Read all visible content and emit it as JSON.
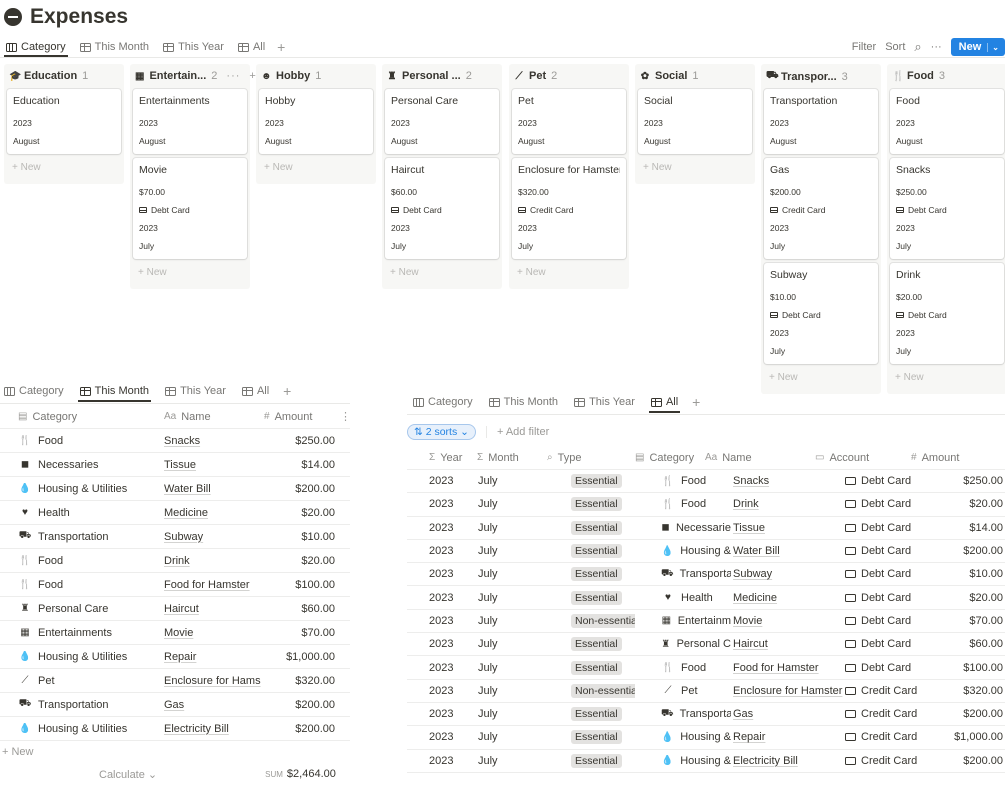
{
  "page": {
    "title": "Expenses"
  },
  "top": {
    "tabs": [
      {
        "label": "Category",
        "icon": "board-icon",
        "active": true
      },
      {
        "label": "This Month",
        "icon": "table-icon"
      },
      {
        "label": "This Year",
        "icon": "table-icon"
      },
      {
        "label": "All",
        "icon": "table-icon"
      }
    ],
    "add": "+",
    "tools": {
      "filter": "Filter",
      "sort": "Sort",
      "search": "⌕",
      "more": "···",
      "new": "New",
      "new_chev": "⌄"
    }
  },
  "board": {
    "columns": [
      {
        "name": "Education",
        "icon": "graduation-cap-icon",
        "glyph": "🎓",
        "count": "1",
        "new_label": "New",
        "cards": [
          {
            "title": "Education",
            "year": "2023",
            "month": "August"
          }
        ]
      },
      {
        "name": "Entertain...",
        "icon": "film-icon",
        "glyph": "▦",
        "count": "2",
        "more": "···",
        "plus": "+",
        "new_label": "New",
        "cards": [
          {
            "title": "Entertainments",
            "year": "2023",
            "month": "August"
          },
          {
            "title": "Movie",
            "amount": "$70.00",
            "account": "Debt Card",
            "year": "2023",
            "month": "July"
          }
        ]
      },
      {
        "name": "Hobby",
        "icon": "smile-icon",
        "glyph": "☻",
        "count": "1",
        "new_label": "New",
        "cards": [
          {
            "title": "Hobby",
            "year": "2023",
            "month": "August"
          }
        ]
      },
      {
        "name": "Personal ...",
        "icon": "bottles-icon",
        "glyph": "♜",
        "count": "2",
        "new_label": "New",
        "cards": [
          {
            "title": "Personal Care",
            "year": "2023",
            "month": "August"
          },
          {
            "title": "Haircut",
            "amount": "$60.00",
            "account": "Debt Card",
            "year": "2023",
            "month": "July"
          }
        ]
      },
      {
        "name": "Pet",
        "icon": "bone-icon",
        "glyph": "⟋",
        "count": "2",
        "new_label": "New",
        "cards": [
          {
            "title": "Pet",
            "year": "2023",
            "month": "August"
          },
          {
            "title": "Enclosure for Hamster",
            "amount": "$320.00",
            "account": "Credit Card",
            "year": "2023",
            "month": "July"
          }
        ]
      },
      {
        "name": "Social",
        "icon": "gift-icon",
        "glyph": "✿",
        "count": "1",
        "new_label": "New",
        "cards": [
          {
            "title": "Social",
            "year": "2023",
            "month": "August"
          }
        ]
      },
      {
        "name": "Transpor...",
        "icon": "car-icon",
        "glyph": "⛟",
        "count": "3",
        "new_label": "New",
        "cards": [
          {
            "title": "Transportation",
            "year": "2023",
            "month": "August"
          },
          {
            "title": "Gas",
            "amount": "$200.00",
            "account": "Credit Card",
            "year": "2023",
            "month": "July"
          },
          {
            "title": "Subway",
            "amount": "$10.00",
            "account": "Debt Card",
            "year": "2023",
            "month": "July"
          }
        ]
      },
      {
        "name": "Food",
        "icon": "fork-knife-icon",
        "glyph": "🍴",
        "count": "3",
        "new_label": "New",
        "cards": [
          {
            "title": "Food",
            "year": "2023",
            "month": "August"
          },
          {
            "title": "Snacks",
            "amount": "$250.00",
            "account": "Debt Card",
            "year": "2023",
            "month": "July"
          },
          {
            "title": "Drink",
            "amount": "$20.00",
            "account": "Debt Card",
            "year": "2023",
            "month": "July"
          }
        ]
      }
    ]
  },
  "month_view": {
    "tabs": [
      {
        "label": "Category",
        "icon": "board-icon"
      },
      {
        "label": "This Month",
        "icon": "table-icon",
        "active": true
      },
      {
        "label": "This Year",
        "icon": "table-icon"
      },
      {
        "label": "All",
        "icon": "table-icon"
      }
    ],
    "add": "+",
    "headers": {
      "category": "Category",
      "name": "Name",
      "amount": "Amount",
      "name_prefix": "Aa",
      "amount_prefix": "#",
      "more": "⋮"
    },
    "rows": [
      {
        "category": "Food",
        "glyph": "🍴",
        "name": "Snacks",
        "amount": "$250.00"
      },
      {
        "category": "Necessaries",
        "glyph": "◼",
        "name": "Tissue",
        "amount": "$14.00"
      },
      {
        "category": "Housing & Utilities",
        "glyph": "💧",
        "name": "Water Bill",
        "amount": "$200.00"
      },
      {
        "category": "Health",
        "glyph": "♥",
        "name": "Medicine",
        "amount": "$20.00"
      },
      {
        "category": "Transportation",
        "glyph": "⛟",
        "name": "Subway",
        "amount": "$10.00"
      },
      {
        "category": "Food",
        "glyph": "🍴",
        "name": "Drink",
        "amount": "$20.00"
      },
      {
        "category": "Food",
        "glyph": "🍴",
        "name": "Food for Hamster",
        "amount": "$100.00"
      },
      {
        "category": "Personal Care",
        "glyph": "♜",
        "name": "Haircut",
        "amount": "$60.00"
      },
      {
        "category": "Entertainments",
        "glyph": "▦",
        "name": "Movie",
        "amount": "$70.00"
      },
      {
        "category": "Housing & Utilities",
        "glyph": "💧",
        "name": "Repair",
        "amount": "$1,000.00"
      },
      {
        "category": "Pet",
        "glyph": "⟋",
        "name": "Enclosure for Hams",
        "amount": "$320.00"
      },
      {
        "category": "Transportation",
        "glyph": "⛟",
        "name": "Gas",
        "amount": "$200.00"
      },
      {
        "category": "Housing & Utilities",
        "glyph": "💧",
        "name": "Electricity Bill",
        "amount": "$200.00"
      }
    ],
    "new_label": "+ New",
    "calculate": "Calculate ⌄",
    "sum_label": "SUM",
    "sum_value": "$2,464.00"
  },
  "all_view": {
    "tabs": [
      {
        "label": "Category",
        "icon": "board-icon"
      },
      {
        "label": "This Month",
        "icon": "table-icon"
      },
      {
        "label": "This Year",
        "icon": "table-icon"
      },
      {
        "label": "All",
        "icon": "table-icon",
        "active": true
      }
    ],
    "add": "+",
    "sorts": "⇅ 2 sorts ⌄",
    "add_filter": "+ Add filter",
    "headers": {
      "year": "Year",
      "month": "Month",
      "type": "Type",
      "category": "Category",
      "name": "Name",
      "account": "Account",
      "amount": "Amount",
      "sigma": "Σ",
      "search": "⌕",
      "aa": "Aa",
      "hash": "#"
    },
    "rows": [
      {
        "year": "2023",
        "month": "July",
        "type": "Essential",
        "category": "Food",
        "glyph": "🍴",
        "name": "Snacks",
        "account": "Debt Card",
        "amount": "$250.00"
      },
      {
        "year": "2023",
        "month": "July",
        "type": "Essential",
        "category": "Food",
        "glyph": "🍴",
        "name": "Drink",
        "account": "Debt Card",
        "amount": "$20.00"
      },
      {
        "year": "2023",
        "month": "July",
        "type": "Essential",
        "category": "Necessarie",
        "glyph": "◼",
        "name": "Tissue",
        "account": "Debt Card",
        "amount": "$14.00"
      },
      {
        "year": "2023",
        "month": "July",
        "type": "Essential",
        "category": "Housing &",
        "glyph": "💧",
        "name": "Water Bill",
        "account": "Debt Card",
        "amount": "$200.00"
      },
      {
        "year": "2023",
        "month": "July",
        "type": "Essential",
        "category": "Transporta",
        "glyph": "⛟",
        "name": "Subway",
        "account": "Debt Card",
        "amount": "$10.00"
      },
      {
        "year": "2023",
        "month": "July",
        "type": "Essential",
        "category": "Health",
        "glyph": "♥",
        "name": "Medicine",
        "account": "Debt Card",
        "amount": "$20.00"
      },
      {
        "year": "2023",
        "month": "July",
        "type": "Non-essential",
        "category": "Entertainm",
        "glyph": "▦",
        "name": "Movie",
        "account": "Debt Card",
        "amount": "$70.00"
      },
      {
        "year": "2023",
        "month": "July",
        "type": "Essential",
        "category": "Personal C",
        "glyph": "♜",
        "name": "Haircut",
        "account": "Debt Card",
        "amount": "$60.00"
      },
      {
        "year": "2023",
        "month": "July",
        "type": "Essential",
        "category": "Food",
        "glyph": "🍴",
        "name": "Food for Hamster",
        "account": "Debt Card",
        "amount": "$100.00"
      },
      {
        "year": "2023",
        "month": "July",
        "type": "Non-essential",
        "category": "Pet",
        "glyph": "⟋",
        "name": "Enclosure for Hamster",
        "account": "Credit Card",
        "amount": "$320.00"
      },
      {
        "year": "2023",
        "month": "July",
        "type": "Essential",
        "category": "Transporta",
        "glyph": "⛟",
        "name": "Gas",
        "account": "Credit Card",
        "amount": "$200.00"
      },
      {
        "year": "2023",
        "month": "July",
        "type": "Essential",
        "category": "Housing &",
        "glyph": "💧",
        "name": "Repair",
        "account": "Credit Card",
        "amount": "$1,000.00"
      },
      {
        "year": "2023",
        "month": "July",
        "type": "Essential",
        "category": "Housing &",
        "glyph": "💧",
        "name": "Electricity Bill",
        "account": "Credit Card",
        "amount": "$200.00"
      }
    ]
  },
  "colors": {
    "accent": "#2383e2",
    "text": "#37352f",
    "muted": "#787774",
    "tag_bg": "#e3e2e0",
    "column_bg": "#f7f7f5"
  }
}
